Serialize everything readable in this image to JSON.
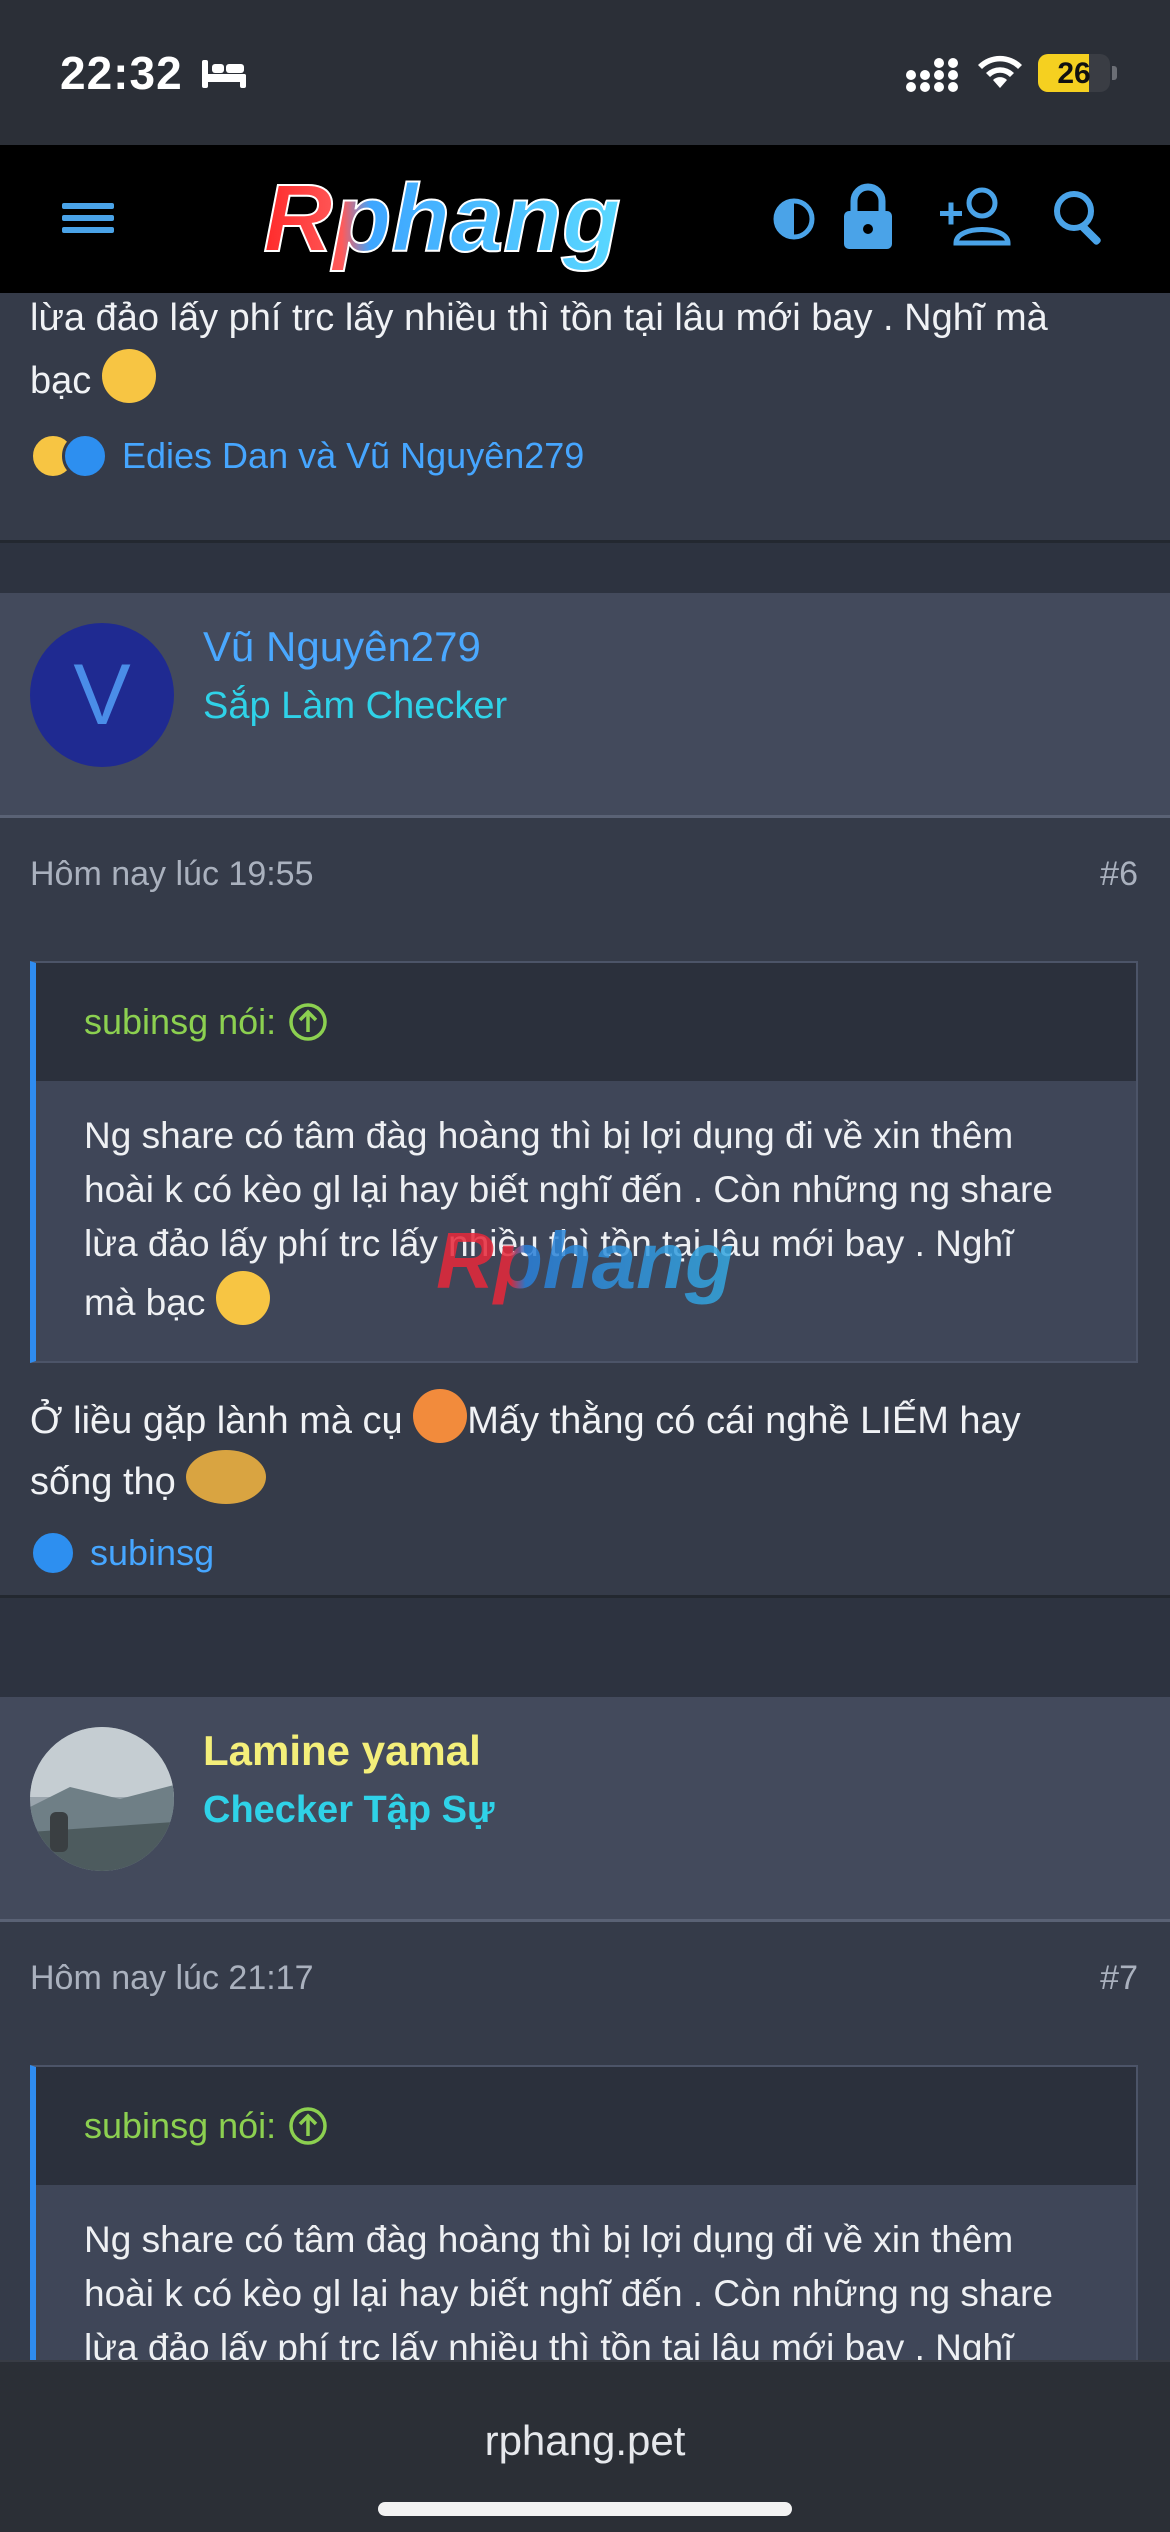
{
  "status_bar": {
    "time": "22:32",
    "battery_level": "26",
    "battery_fraction": 0.26
  },
  "header": {
    "logo_text": "Rphang",
    "icons": [
      "menu-icon",
      "contrast-icon",
      "lock-icon",
      "add-user-icon",
      "search-icon"
    ]
  },
  "post_prev": {
    "text_line1": "lừa đảo lấy phí trc lấy nhiều thì tồn tại lâu mới bay . Nghĩ mà",
    "text_line2": "bạc",
    "reactions_names": "Edies Dan và Vũ Nguyên279"
  },
  "post6": {
    "avatar_letter": "V",
    "username": "Vũ Nguyên279",
    "user_title": "Sắp Làm Checker",
    "timestamp": "Hôm nay lúc 19:55",
    "number": "#6",
    "quote_author": "subinsg nói:",
    "quote_lines": [
      "Ng share có tâm đàg hoàng thì bị lợi dụng đi về xin thêm",
      "hoài k có kèo gl lại hay biết nghĩ đến . Còn những ng share",
      "lừa đảo lấy phí trc lấy nhiều thì tồn tại lâu mới bay . Nghĩ",
      "mà bạc"
    ],
    "body_line1_a": "Ở liều gặp lành mà cụ ",
    "body_line1_b": "Mấy thằng có cái nghề LIẾM hay",
    "body_line2": "sống thọ ",
    "reactions_names": "subinsg"
  },
  "post7": {
    "username": "Lamine yamal",
    "user_title": "Checker Tập Sự",
    "timestamp": "Hôm nay lúc 21:17",
    "number": "#7",
    "quote_author": "subinsg nói:",
    "quote_lines": [
      "Ng share có tâm đàg hoàng thì bị lợi dụng đi về xin thêm",
      "hoài k có kèo gl lại hay biết nghĩ đến . Còn những ng share",
      "lừa đảo lấy phí trc lấy nhiều thì tồn tại lâu mới bay . Nghĩ"
    ]
  },
  "watermark_text": "Rphang",
  "browser": {
    "url": "rphang.pet"
  },
  "colors": {
    "accent_blue": "#46a6ff",
    "name_blue": "#4aa8ff",
    "title_cyan": "#2fd2e8",
    "name_yellow": "#f4ef7a",
    "quote_green": "#8cd050",
    "background": "#2d3340"
  }
}
